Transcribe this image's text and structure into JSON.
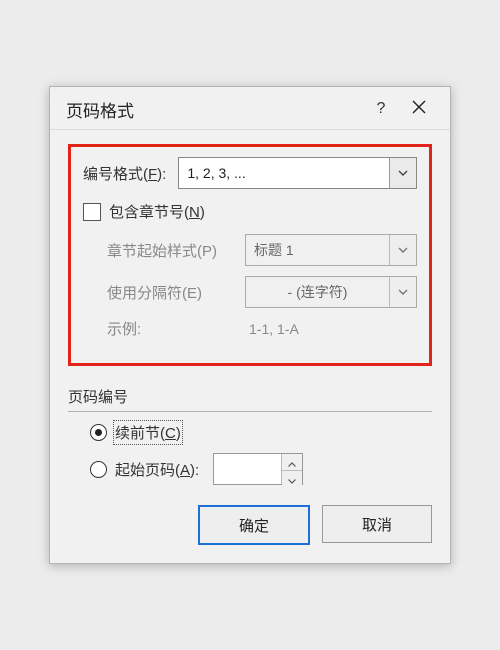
{
  "titlebar": {
    "title": "页码格式",
    "help": "?"
  },
  "main": {
    "number_format_label": "编号格式(",
    "number_format_mn": "F",
    "number_format_label_tail": "):",
    "number_format_value": "1, 2, 3, ...",
    "include_chapter_label": "包含章节号(",
    "include_chapter_mn": "N",
    "include_chapter_tail": ")",
    "chapter_start_label": "章节起始样式(P)",
    "chapter_start_value": "标题 1",
    "separator_label": "使用分隔符(E)",
    "separator_value": "-  (连字符)",
    "example_label": "示例:",
    "example_value": "1-1, 1-A"
  },
  "numbering": {
    "group_label": "页码编号",
    "continue_label": "续前节(",
    "continue_mn": "C",
    "continue_tail": ")",
    "start_at_label": "起始页码(",
    "start_at_mn": "A",
    "start_at_tail": "):",
    "start_at_value": ""
  },
  "buttons": {
    "ok": "确定",
    "cancel": "取消"
  }
}
